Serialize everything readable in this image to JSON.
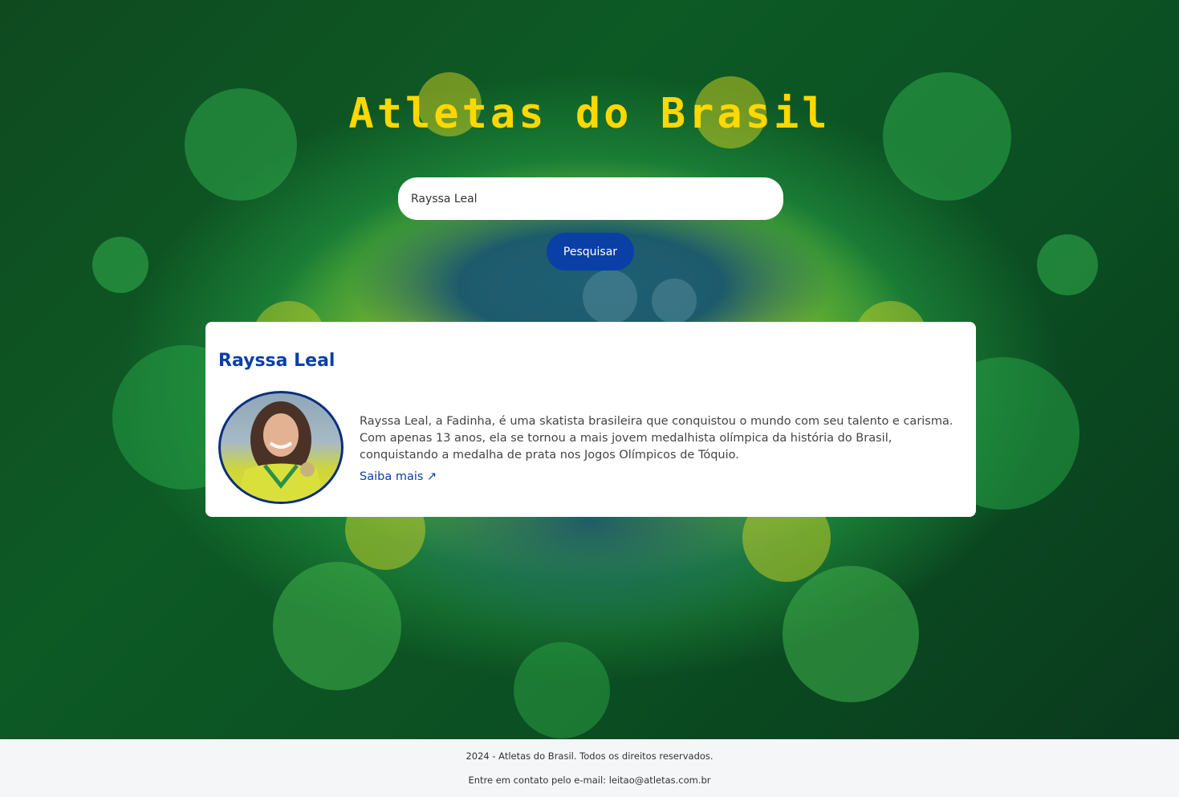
{
  "hero": {
    "title": "Atletas do Brasil"
  },
  "search": {
    "value": "Rayssa Leal",
    "button_label": "Pesquisar"
  },
  "result": {
    "name": "Rayssa Leal",
    "description": "Rayssa Leal, a Fadinha, é uma skatista brasileira que conquistou o mundo com seu talento e carisma. Com apenas 13 anos, ela se tornou a mais jovem medalhista olímpica da história do Brasil, conquistando a medalha de prata nos Jogos Olímpicos de Tóquio.",
    "link_label": "Saiba mais ↗"
  },
  "footer": {
    "copyright": "2024 - Atletas do Brasil. Todos os direitos reservados.",
    "contact": "Entre em contato pelo e-mail: leitao@atletas.com.br"
  },
  "colors": {
    "title": "#ffd800",
    "accent_blue": "#0a3fa5",
    "background_green": "#0d5a25"
  }
}
